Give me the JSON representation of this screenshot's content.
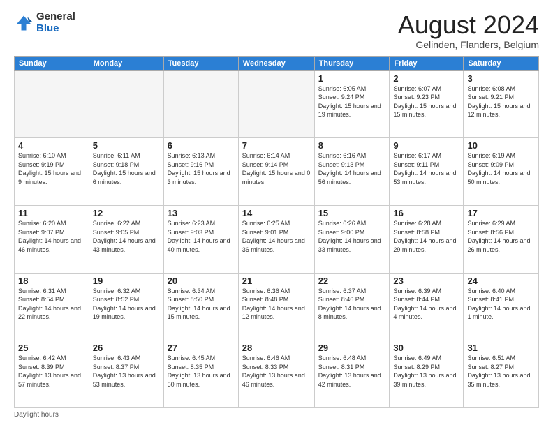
{
  "logo": {
    "general": "General",
    "blue": "Blue"
  },
  "header": {
    "month": "August 2024",
    "location": "Gelinden, Flanders, Belgium"
  },
  "weekdays": [
    "Sunday",
    "Monday",
    "Tuesday",
    "Wednesday",
    "Thursday",
    "Friday",
    "Saturday"
  ],
  "footer": "Daylight hours",
  "weeks": [
    [
      {
        "day": "",
        "info": ""
      },
      {
        "day": "",
        "info": ""
      },
      {
        "day": "",
        "info": ""
      },
      {
        "day": "",
        "info": ""
      },
      {
        "day": "1",
        "info": "Sunrise: 6:05 AM\nSunset: 9:24 PM\nDaylight: 15 hours\nand 19 minutes."
      },
      {
        "day": "2",
        "info": "Sunrise: 6:07 AM\nSunset: 9:23 PM\nDaylight: 15 hours\nand 15 minutes."
      },
      {
        "day": "3",
        "info": "Sunrise: 6:08 AM\nSunset: 9:21 PM\nDaylight: 15 hours\nand 12 minutes."
      }
    ],
    [
      {
        "day": "4",
        "info": "Sunrise: 6:10 AM\nSunset: 9:19 PM\nDaylight: 15 hours\nand 9 minutes."
      },
      {
        "day": "5",
        "info": "Sunrise: 6:11 AM\nSunset: 9:18 PM\nDaylight: 15 hours\nand 6 minutes."
      },
      {
        "day": "6",
        "info": "Sunrise: 6:13 AM\nSunset: 9:16 PM\nDaylight: 15 hours\nand 3 minutes."
      },
      {
        "day": "7",
        "info": "Sunrise: 6:14 AM\nSunset: 9:14 PM\nDaylight: 15 hours\nand 0 minutes."
      },
      {
        "day": "8",
        "info": "Sunrise: 6:16 AM\nSunset: 9:13 PM\nDaylight: 14 hours\nand 56 minutes."
      },
      {
        "day": "9",
        "info": "Sunrise: 6:17 AM\nSunset: 9:11 PM\nDaylight: 14 hours\nand 53 minutes."
      },
      {
        "day": "10",
        "info": "Sunrise: 6:19 AM\nSunset: 9:09 PM\nDaylight: 14 hours\nand 50 minutes."
      }
    ],
    [
      {
        "day": "11",
        "info": "Sunrise: 6:20 AM\nSunset: 9:07 PM\nDaylight: 14 hours\nand 46 minutes."
      },
      {
        "day": "12",
        "info": "Sunrise: 6:22 AM\nSunset: 9:05 PM\nDaylight: 14 hours\nand 43 minutes."
      },
      {
        "day": "13",
        "info": "Sunrise: 6:23 AM\nSunset: 9:03 PM\nDaylight: 14 hours\nand 40 minutes."
      },
      {
        "day": "14",
        "info": "Sunrise: 6:25 AM\nSunset: 9:01 PM\nDaylight: 14 hours\nand 36 minutes."
      },
      {
        "day": "15",
        "info": "Sunrise: 6:26 AM\nSunset: 9:00 PM\nDaylight: 14 hours\nand 33 minutes."
      },
      {
        "day": "16",
        "info": "Sunrise: 6:28 AM\nSunset: 8:58 PM\nDaylight: 14 hours\nand 29 minutes."
      },
      {
        "day": "17",
        "info": "Sunrise: 6:29 AM\nSunset: 8:56 PM\nDaylight: 14 hours\nand 26 minutes."
      }
    ],
    [
      {
        "day": "18",
        "info": "Sunrise: 6:31 AM\nSunset: 8:54 PM\nDaylight: 14 hours\nand 22 minutes."
      },
      {
        "day": "19",
        "info": "Sunrise: 6:32 AM\nSunset: 8:52 PM\nDaylight: 14 hours\nand 19 minutes."
      },
      {
        "day": "20",
        "info": "Sunrise: 6:34 AM\nSunset: 8:50 PM\nDaylight: 14 hours\nand 15 minutes."
      },
      {
        "day": "21",
        "info": "Sunrise: 6:36 AM\nSunset: 8:48 PM\nDaylight: 14 hours\nand 12 minutes."
      },
      {
        "day": "22",
        "info": "Sunrise: 6:37 AM\nSunset: 8:46 PM\nDaylight: 14 hours\nand 8 minutes."
      },
      {
        "day": "23",
        "info": "Sunrise: 6:39 AM\nSunset: 8:44 PM\nDaylight: 14 hours\nand 4 minutes."
      },
      {
        "day": "24",
        "info": "Sunrise: 6:40 AM\nSunset: 8:41 PM\nDaylight: 14 hours\nand 1 minute."
      }
    ],
    [
      {
        "day": "25",
        "info": "Sunrise: 6:42 AM\nSunset: 8:39 PM\nDaylight: 13 hours\nand 57 minutes."
      },
      {
        "day": "26",
        "info": "Sunrise: 6:43 AM\nSunset: 8:37 PM\nDaylight: 13 hours\nand 53 minutes."
      },
      {
        "day": "27",
        "info": "Sunrise: 6:45 AM\nSunset: 8:35 PM\nDaylight: 13 hours\nand 50 minutes."
      },
      {
        "day": "28",
        "info": "Sunrise: 6:46 AM\nSunset: 8:33 PM\nDaylight: 13 hours\nand 46 minutes."
      },
      {
        "day": "29",
        "info": "Sunrise: 6:48 AM\nSunset: 8:31 PM\nDaylight: 13 hours\nand 42 minutes."
      },
      {
        "day": "30",
        "info": "Sunrise: 6:49 AM\nSunset: 8:29 PM\nDaylight: 13 hours\nand 39 minutes."
      },
      {
        "day": "31",
        "info": "Sunrise: 6:51 AM\nSunset: 8:27 PM\nDaylight: 13 hours\nand 35 minutes."
      }
    ]
  ]
}
